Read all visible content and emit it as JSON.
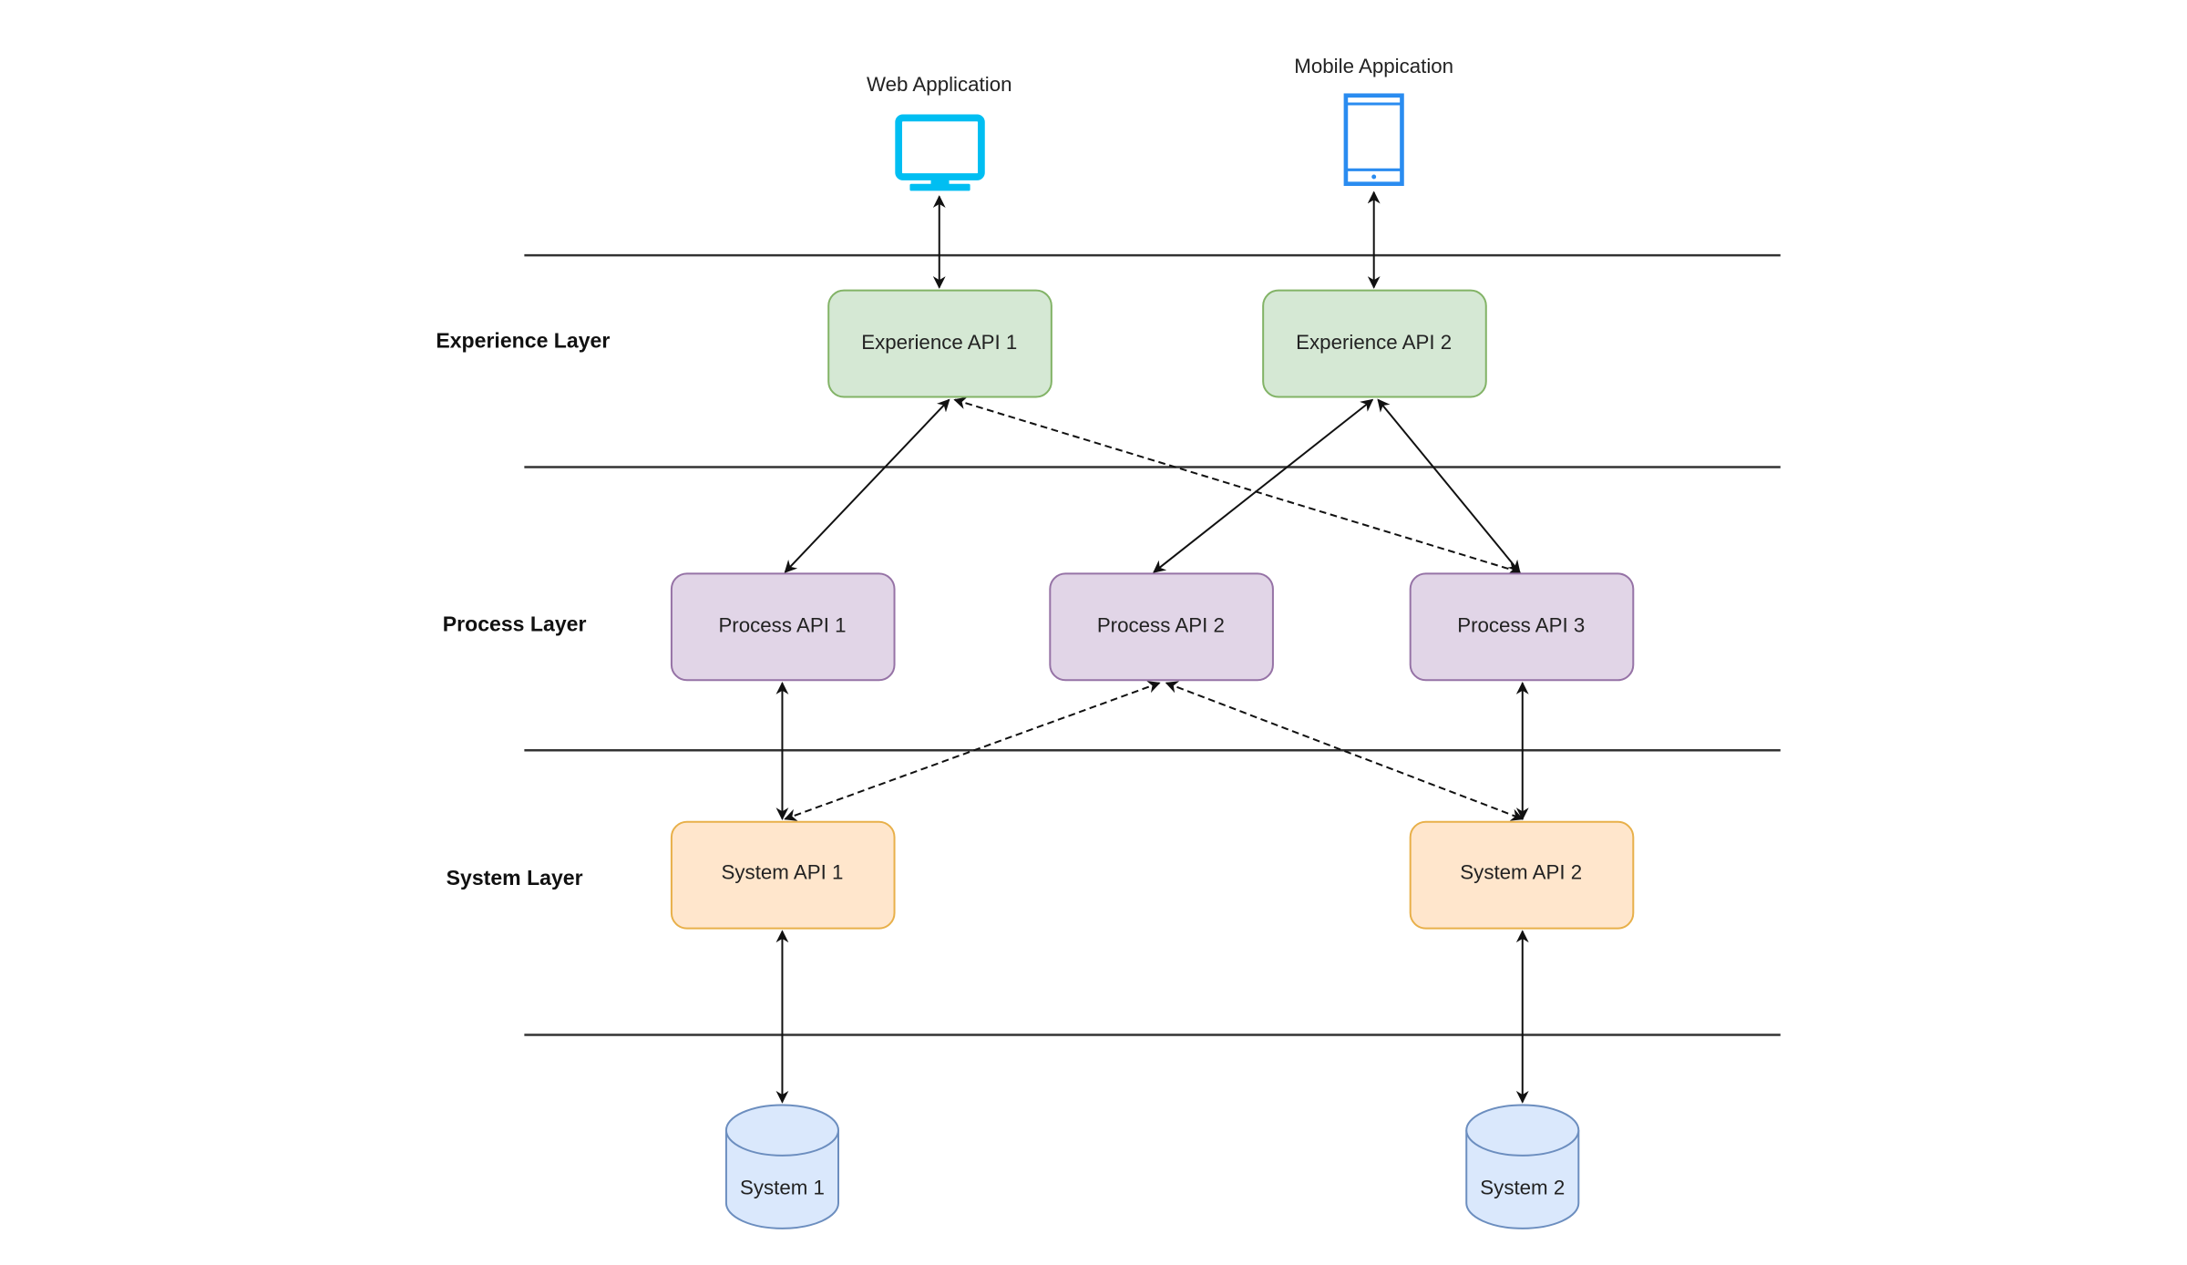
{
  "clients": [
    {
      "label": "Web Application",
      "icon": "monitor-icon",
      "color": "#00bef2"
    },
    {
      "label": "Mobile Appication",
      "icon": "mobile-phone-icon",
      "color": "#2a8cf0"
    }
  ],
  "layers": [
    {
      "label": "Experience Layer"
    },
    {
      "label": "Process Layer"
    },
    {
      "label": "System Layer"
    }
  ],
  "experience_apis": [
    {
      "label": "Experience API 1"
    },
    {
      "label": "Experience API 2"
    }
  ],
  "process_apis": [
    {
      "label": "Process API 1"
    },
    {
      "label": "Process API 2"
    },
    {
      "label": "Process API 3"
    }
  ],
  "system_apis": [
    {
      "label": "System API 1"
    },
    {
      "label": "System API 2"
    }
  ],
  "systems": [
    {
      "label": "System 1",
      "icon": "database-icon"
    },
    {
      "label": "System 2",
      "icon": "database-icon"
    }
  ],
  "colors": {
    "experience_fill": "#d5e8d4",
    "experience_stroke": "#82b366",
    "process_fill": "#e1d5e7",
    "process_stroke": "#9673a6",
    "system_fill": "#ffe6cc",
    "system_stroke": "#e8b04a",
    "database_fill": "#dae8fc",
    "database_stroke": "#6c8ebf"
  },
  "connections": [
    {
      "from": "Web Application",
      "to": "Experience API 1",
      "style": "solid",
      "bidirectional": true
    },
    {
      "from": "Mobile Appication",
      "to": "Experience API 2",
      "style": "solid",
      "bidirectional": true
    },
    {
      "from": "Experience API 1",
      "to": "Process API 1",
      "style": "solid",
      "bidirectional": true
    },
    {
      "from": "Experience API 1",
      "to": "Process API 3",
      "style": "dashed",
      "bidirectional": true
    },
    {
      "from": "Experience API 2",
      "to": "Process API 2",
      "style": "solid",
      "bidirectional": true
    },
    {
      "from": "Experience API 2",
      "to": "Process API 3",
      "style": "solid",
      "bidirectional": true
    },
    {
      "from": "Process API 1",
      "to": "System API 1",
      "style": "solid",
      "bidirectional": true
    },
    {
      "from": "Process API 3",
      "to": "System API 2",
      "style": "solid",
      "bidirectional": true
    },
    {
      "from": "Process API 2",
      "to": "System API 1",
      "style": "dashed",
      "bidirectional": true
    },
    {
      "from": "Process API 2",
      "to": "System API 2",
      "style": "dashed",
      "bidirectional": true
    },
    {
      "from": "System API 1",
      "to": "System 1",
      "style": "solid",
      "bidirectional": true
    },
    {
      "from": "System API 2",
      "to": "System 2",
      "style": "solid",
      "bidirectional": true
    }
  ]
}
